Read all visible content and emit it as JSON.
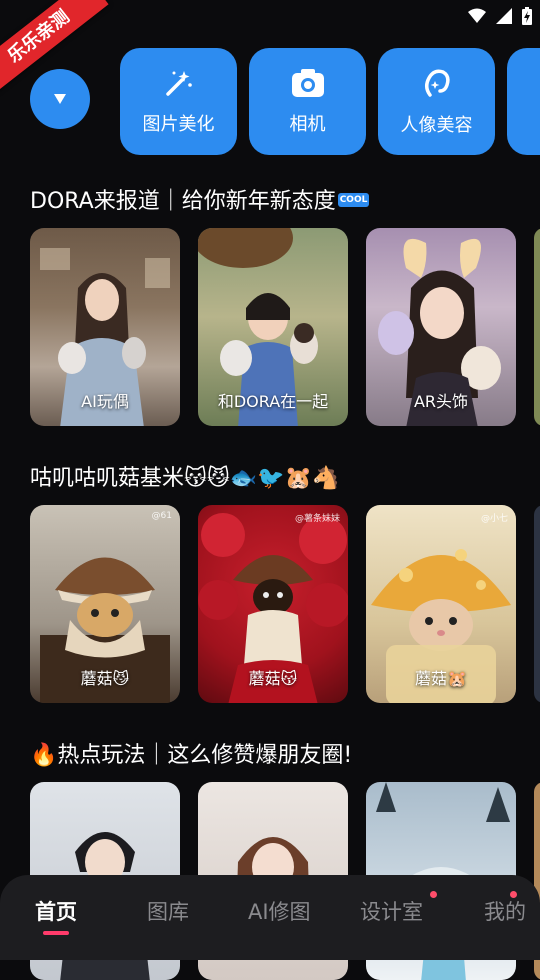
{
  "corner_badge": "乐乐亲测",
  "toolbar": {
    "tools": [
      {
        "label": "图片美化",
        "icon": "magic-wand-icon"
      },
      {
        "label": "相机",
        "icon": "camera-icon"
      },
      {
        "label": "人像美容",
        "icon": "portrait-beauty-icon"
      }
    ]
  },
  "sections": [
    {
      "title": "DORA来报道｜给你新年新态度",
      "title_emoji": "COOL",
      "cards": [
        {
          "caption": "AI玩偶"
        },
        {
          "caption": "和DORA在一起"
        },
        {
          "caption": "AR头饰"
        }
      ]
    },
    {
      "title": "咕叽咕叽菇基米😽😼🐟🐦🐹🐴",
      "cards": [
        {
          "caption": "蘑菇😼",
          "watermark": "@61"
        },
        {
          "caption": "蘑菇😽",
          "watermark": "@薯条妹妹"
        },
        {
          "caption": "蘑菇🐹",
          "watermark": "@小七"
        }
      ]
    },
    {
      "title": "🔥热点玩法｜这么修赞爆朋友圈!",
      "cards": [
        {},
        {},
        {}
      ]
    }
  ],
  "tabbar": {
    "tabs": [
      {
        "label": "首页",
        "active": true
      },
      {
        "label": "图库"
      },
      {
        "label": "AI修图"
      },
      {
        "label": "设计室",
        "dot": true
      },
      {
        "label": "我的",
        "dot": true
      }
    ]
  },
  "colors": {
    "accent": "#2d8cf0",
    "background": "#0b0b0d",
    "tabbar": "#1d1d20",
    "badge": "#e1262b",
    "active_underline": "#ff3b6b"
  }
}
